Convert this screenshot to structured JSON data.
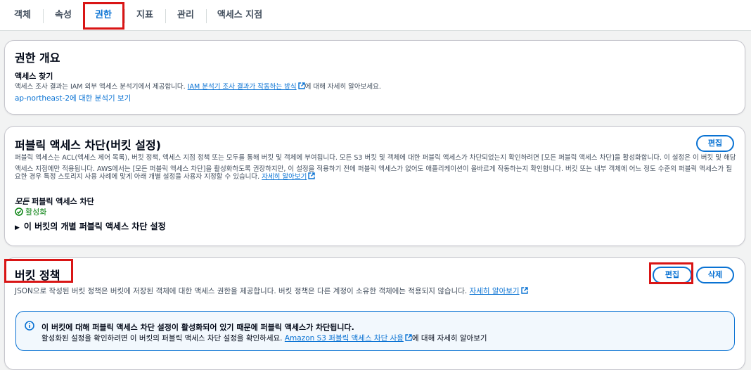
{
  "tabs": [
    {
      "label": "객체"
    },
    {
      "label": "속성"
    },
    {
      "label": "권한",
      "active": true
    },
    {
      "label": "지표"
    },
    {
      "label": "관리"
    },
    {
      "label": "액세스 지점"
    }
  ],
  "overview": {
    "title": "권한 개요",
    "access_finder_label": "액세스 찾기",
    "desc_prefix": "액세스 조사 결과는 IAM 외부 액세스 분석기에서 제공합니다. ",
    "desc_link": "IAM 분석기 조사 결과가 작동하는 방식",
    "desc_suffix": "에 대해 자세히 알아보세요.",
    "analyzer_link": "ap-northeast-2에 대한 분석기 보기"
  },
  "block_public": {
    "title": "퍼블릭 액세스 차단(버킷 설정)",
    "edit_label": "편집",
    "desc_line1": "퍼블릭 액세스는 ACL(액세스 제어 목록), 버킷 정책, 액세스 지점 정책 또는 모두를 통해 버킷 및 객체에 부여됩니다. 모든 S3 버킷 및 객체에 대한 퍼블릭 액세스가 차단되었는지 확인하려면 [모든 퍼블릭 액세스 차단]을 활성화합니다. 이 설정은 이 버킷 및 해당",
    "desc_line2": "액세스 지점에만 적용됩니다. AWS에서는 [모든 퍼블릭 액세스 차단]을 활성화하도록 권장하지만, 이 설정을 적용하기 전에 퍼블릭 액세스가 없어도 애플리케이션이 올바르게 작동하는지 확인합니다. 버킷 또는 내부 객체에 어느 정도 수준의 퍼블릭 액세스가 필",
    "desc_line3": "요한 경우 특정 스토리지 사용 사례에 맞게 아래 개별 설정을 사용자 지정할 수 있습니다. ",
    "learn_more": "자세히 알아보기",
    "all_label_italic": "모든",
    "all_label_rest": " 퍼블릭 액세스 차단",
    "status": "활성화",
    "expander": "이 버킷의 개별 퍼블릭 액세스 차단 설정"
  },
  "bucket_policy": {
    "title": "버킷 정책",
    "edit_label": "편집",
    "delete_label": "삭제",
    "desc": "JSON으로 작성된 버킷 정책은 버킷에 저장된 객체에 대한 액세스 권한을 제공합니다. 버킷 정책은 다른 계정이 소유한 객체에는 적용되지 않습니다. ",
    "learn_more": "자세히 알아보기",
    "info_title": "이 버킷에 대해 퍼블릭 액세스 차단 설정이 활성화되어 있기 때문에 퍼블릭 액세스가 차단됩니다.",
    "info_prefix": "활성화된 설정을 확인하려면 이 버킷의 퍼블릭 액세스 차단 설정을 확인하세요. ",
    "info_link": "Amazon S3 퍼블릭 액세스 차단 사용",
    "info_suffix": "에 대해 자세히 알아보기"
  },
  "colors": {
    "accent": "#0972d3",
    "success": "#037f0c",
    "highlight": "#d91515"
  }
}
